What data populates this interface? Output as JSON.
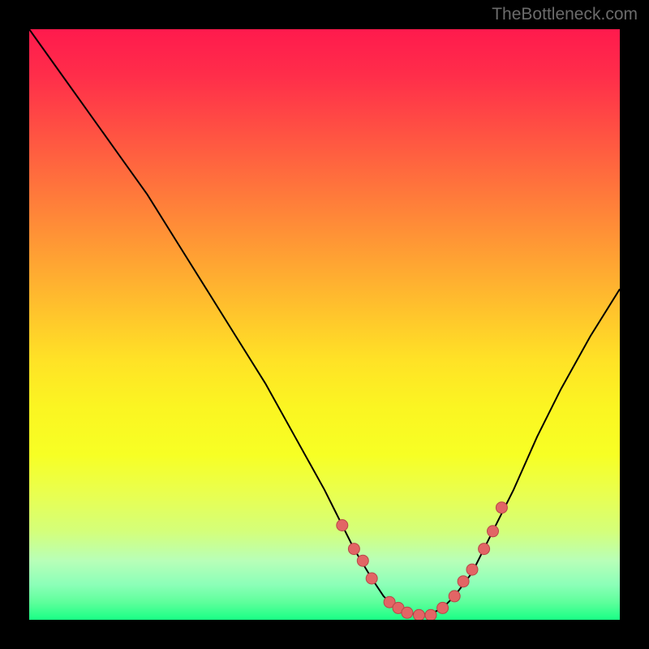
{
  "watermark": "TheBottleneck.com",
  "chart_data": {
    "type": "line",
    "title": "",
    "xlabel": "",
    "ylabel": "",
    "xlim": [
      0,
      100
    ],
    "ylim": [
      0,
      100
    ],
    "background": "gradient red-yellow-green vertical",
    "series": [
      {
        "name": "bottleneck-curve",
        "color": "#000000",
        "x": [
          0,
          5,
          10,
          15,
          20,
          25,
          30,
          35,
          40,
          45,
          50,
          52,
          55,
          58,
          60,
          62,
          65,
          68,
          70,
          72,
          75,
          78,
          82,
          86,
          90,
          95,
          100
        ],
        "y": [
          100,
          93,
          86,
          79,
          72,
          64,
          56,
          48,
          40,
          31,
          22,
          18,
          12,
          7,
          4,
          2,
          1,
          1,
          2,
          4,
          8,
          14,
          22,
          31,
          39,
          48,
          56
        ]
      }
    ],
    "markers": {
      "name": "highlight-points",
      "color": "#e26565",
      "x": [
        53,
        55,
        56.5,
        58,
        61,
        62.5,
        64,
        66,
        68,
        70,
        72,
        73.5,
        75,
        77,
        78.5,
        80
      ],
      "y": [
        16,
        12,
        10,
        7,
        3,
        2,
        1.2,
        0.8,
        0.8,
        2,
        4,
        6.5,
        8.5,
        12,
        15,
        19
      ]
    }
  }
}
